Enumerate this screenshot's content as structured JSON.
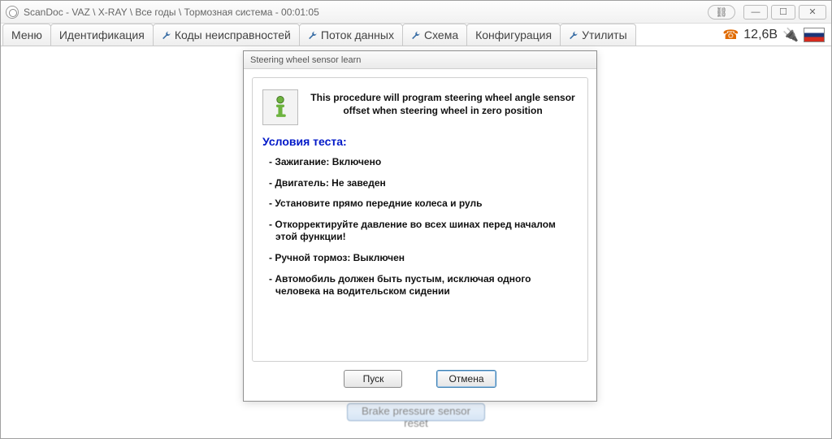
{
  "window": {
    "title": "ScanDoc - VAZ \\ X-RAY \\ Все годы \\ Тормозная система - 00:01:05"
  },
  "tabs": {
    "menu": "Меню",
    "ident": "Идентификация",
    "codes": "Коды неисправностей",
    "stream": "Поток данных",
    "scheme": "Схема",
    "config": "Конфигурация",
    "utils": "Утилиты"
  },
  "status": {
    "voltage": "12,6В"
  },
  "dialog": {
    "title": "Steering wheel sensor learn",
    "procedure": "This procedure will program steering wheel angle sensor offset when steering wheel in zero position",
    "conditions_title": "Условия теста:",
    "conditions": [
      "- Зажигание: Включено",
      "- Двигатель: Не заведен",
      "- Установите прямо передние колеса и руль",
      "- Откорректируйте давление во всех шинах перед началом этой функции!",
      "- Ручной тормоз: Выключен",
      "- Автомобиль должен быть пустым, исключая одного человека на водительском сидении"
    ],
    "btn_start": "Пуск",
    "btn_cancel": "Отмена"
  },
  "background_button": "Brake pressure sensor reset"
}
